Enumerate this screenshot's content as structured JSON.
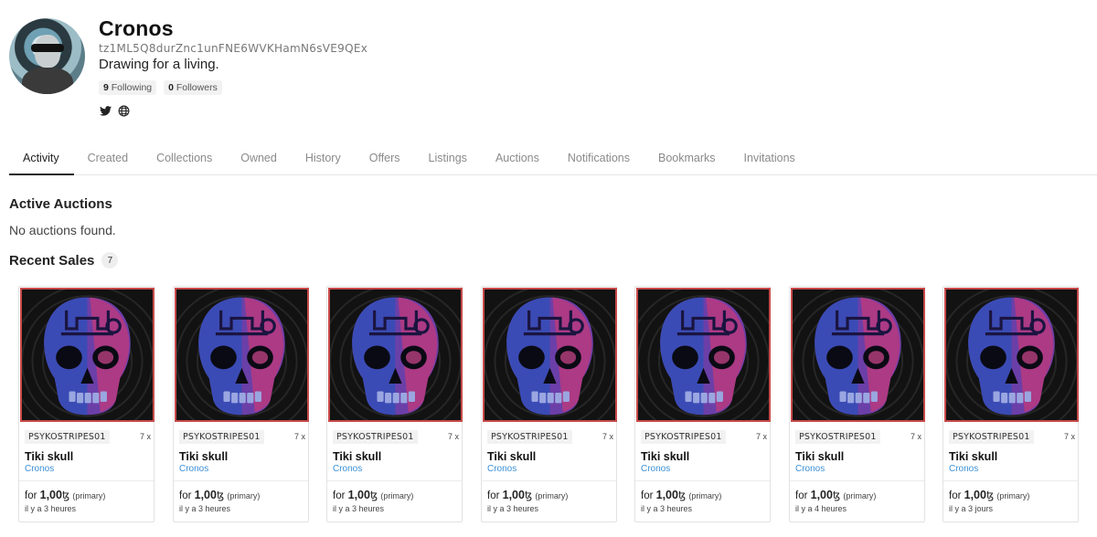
{
  "profile": {
    "name": "Cronos",
    "address": "tz1ML5Q8durZnc1unFNE6WVKHamN6sVE9QEx",
    "bio": "Drawing for a living.",
    "following_count": "9",
    "following_label": "Following",
    "followers_count": "0",
    "followers_label": "Followers",
    "social_icons": [
      "twitter-icon",
      "globe-icon"
    ]
  },
  "tabs": [
    {
      "label": "Activity",
      "active": true
    },
    {
      "label": "Created"
    },
    {
      "label": "Collections"
    },
    {
      "label": "Owned"
    },
    {
      "label": "History"
    },
    {
      "label": "Offers"
    },
    {
      "label": "Listings"
    },
    {
      "label": "Auctions"
    },
    {
      "label": "Notifications"
    },
    {
      "label": "Bookmarks"
    },
    {
      "label": "Invitations"
    }
  ],
  "active_auctions": {
    "heading": "Active Auctions",
    "empty_text": "No auctions found."
  },
  "recent_sales": {
    "heading": "Recent Sales",
    "count": "7",
    "items": [
      {
        "tag": "PSYKOSTRIPES01",
        "editions": "7 x",
        "title": "Tiki skull",
        "creator": "Cronos",
        "for_label": "for",
        "price": "1,00",
        "currency": "ꜩ",
        "kind": "(primary)",
        "time": "il y a 3 heures"
      },
      {
        "tag": "PSYKOSTRIPES01",
        "editions": "7 x",
        "title": "Tiki skull",
        "creator": "Cronos",
        "for_label": "for",
        "price": "1,00",
        "currency": "ꜩ",
        "kind": "(primary)",
        "time": "il y a 3 heures"
      },
      {
        "tag": "PSYKOSTRIPES01",
        "editions": "7 x",
        "title": "Tiki skull",
        "creator": "Cronos",
        "for_label": "for",
        "price": "1,00",
        "currency": "ꜩ",
        "kind": "(primary)",
        "time": "il y a 3 heures"
      },
      {
        "tag": "PSYKOSTRIPES01",
        "editions": "7 x",
        "title": "Tiki skull",
        "creator": "Cronos",
        "for_label": "for",
        "price": "1,00",
        "currency": "ꜩ",
        "kind": "(primary)",
        "time": "il y a 3 heures"
      },
      {
        "tag": "PSYKOSTRIPES01",
        "editions": "7 x",
        "title": "Tiki skull",
        "creator": "Cronos",
        "for_label": "for",
        "price": "1,00",
        "currency": "ꜩ",
        "kind": "(primary)",
        "time": "il y a 3 heures"
      },
      {
        "tag": "PSYKOSTRIPES01",
        "editions": "7 x",
        "title": "Tiki skull",
        "creator": "Cronos",
        "for_label": "for",
        "price": "1,00",
        "currency": "ꜩ",
        "kind": "(primary)",
        "time": "il y a 4 heures"
      },
      {
        "tag": "PSYKOSTRIPES01",
        "editions": "7 x",
        "title": "Tiki skull",
        "creator": "Cronos",
        "for_label": "for",
        "price": "1,00",
        "currency": "ꜩ",
        "kind": "(primary)",
        "time": "il y a 3 jours"
      }
    ]
  },
  "colors": {
    "accent_link": "#3a8fd6",
    "art_border": "#c84a4a",
    "tab_active": "#222222",
    "tab_inactive": "#8a8a8a"
  }
}
